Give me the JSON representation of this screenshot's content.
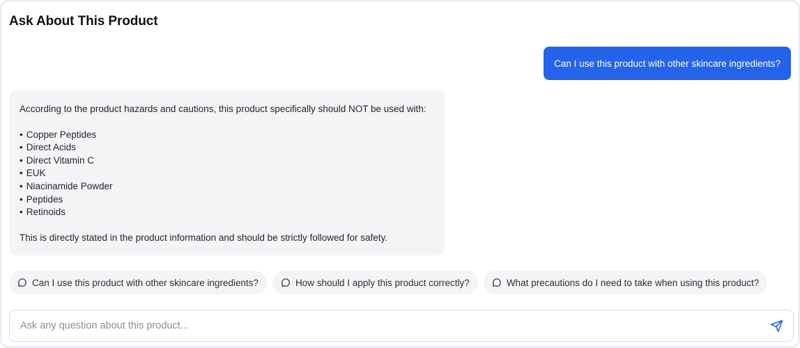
{
  "header": {
    "title": "Ask About This Product"
  },
  "conversation": {
    "user_message": "Can I use this product with other skincare ingredients?",
    "assistant_message": {
      "intro": "According to the product hazards and cautions, this product specifically should NOT be used with:",
      "items": [
        "Copper Peptides",
        "Direct Acids",
        "Direct Vitamin C",
        "EUK",
        "Niacinamide Powder",
        "Peptides",
        "Retinoids"
      ],
      "closing": "This is directly stated in the product information and should be strictly followed for safety."
    }
  },
  "suggestions": [
    {
      "label": "Can I use this product with other skincare ingredients?",
      "icon": "chat-bubble-icon"
    },
    {
      "label": "How should I apply this product correctly?",
      "icon": "chat-bubble-icon"
    },
    {
      "label": "What precautions do I need to take when using this product?",
      "icon": "chat-bubble-icon"
    }
  ],
  "input": {
    "placeholder": "Ask any question about this product...",
    "value": "",
    "send_icon": "send-icon"
  },
  "colors": {
    "accent": "#2563eb",
    "bubble_bg": "#f3f4f6",
    "send_icon": "#2563eb"
  }
}
